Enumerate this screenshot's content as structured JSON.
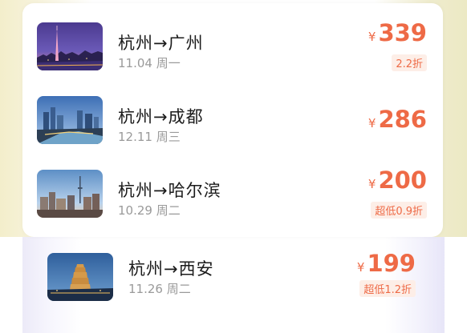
{
  "flights": [
    {
      "route": "杭州→广州",
      "date": "11.04 周一",
      "currency": "¥",
      "price": "339",
      "tag": "2.2折",
      "image": "guangzhou-canton-tower-night-photo"
    },
    {
      "route": "杭州→成都",
      "date": "12.11 周三",
      "currency": "¥",
      "price": "286",
      "tag": "",
      "image": "chengdu-river-city-photo"
    },
    {
      "route": "杭州→哈尔滨",
      "date": "10.29 周二",
      "currency": "¥",
      "price": "200",
      "tag": "超低0.9折",
      "image": "harbin-tower-skyline-photo"
    },
    {
      "route": "杭州→西安",
      "date": "11.26 周二",
      "currency": "¥",
      "price": "199",
      "tag": "超低1.2折",
      "image": "xian-pagoda-night-photo"
    }
  ],
  "colors": {
    "price": "#ee6a46",
    "tag_bg": "#fdeee7",
    "route_text": "#1b1b1b",
    "date_text": "#9a9a9a"
  }
}
